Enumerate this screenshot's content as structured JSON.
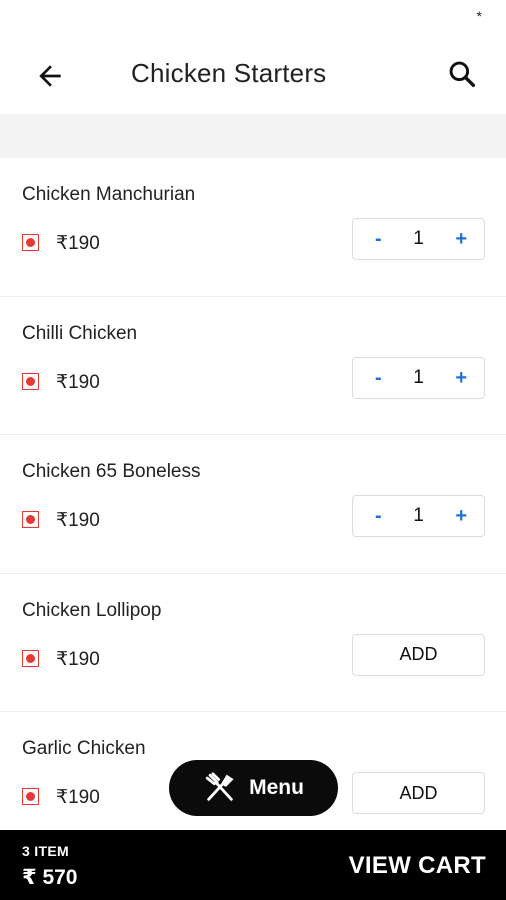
{
  "status_bar": {
    "indicator": "*"
  },
  "header": {
    "title": "Chicken Starters",
    "back_icon": "arrow-left-icon",
    "search_icon": "search-icon"
  },
  "items": [
    {
      "name": "Chicken Manchurian",
      "price": "₹190",
      "qty": "1",
      "in_cart": true
    },
    {
      "name": "Chilli Chicken",
      "price": "₹190",
      "qty": "1",
      "in_cart": true
    },
    {
      "name": "Chicken 65 Boneless",
      "price": "₹190",
      "qty": "1",
      "in_cart": true
    },
    {
      "name": "Chicken Lollipop",
      "price": "₹190",
      "in_cart": false
    },
    {
      "name": "Garlic Chicken",
      "price": "₹190",
      "in_cart": false
    }
  ],
  "controls": {
    "minus": "-",
    "plus": "+",
    "add": "ADD"
  },
  "menu_button": {
    "label": "Menu",
    "icon": "fork-knife-icon"
  },
  "cart": {
    "count": "3 ITEM",
    "total": "₹ 570",
    "action": "VIEW CART"
  },
  "colors": {
    "accent": "#1e6fd9",
    "nonveg_mark": "#e53935",
    "cart_bar": "#000000"
  }
}
